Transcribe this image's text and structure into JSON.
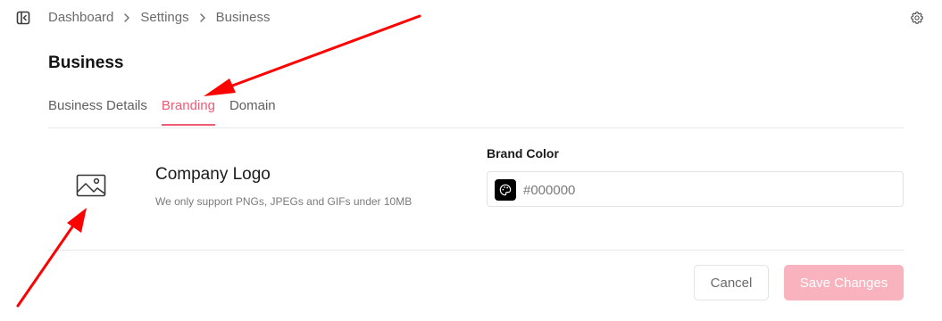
{
  "breadcrumb": {
    "items": [
      "Dashboard",
      "Settings",
      "Business"
    ]
  },
  "page": {
    "title": "Business"
  },
  "tabs": [
    {
      "label": "Business Details",
      "active": false
    },
    {
      "label": "Branding",
      "active": true
    },
    {
      "label": "Domain",
      "active": false
    }
  ],
  "logo": {
    "title": "Company Logo",
    "hint": "We only support PNGs, JPEGs and GIFs under 10MB",
    "icon": "image-icon"
  },
  "brand_color": {
    "label": "Brand Color",
    "value": "",
    "placeholder": "#000000",
    "swatch_color": "#000000",
    "icon": "palette-icon"
  },
  "actions": {
    "cancel_label": "Cancel",
    "save_label": "Save Changes"
  },
  "colors": {
    "accent": "#ef5b75",
    "save_disabled": "#f8b3be",
    "annotation_arrow": "#ff0000"
  },
  "icons": {
    "sidebar_toggle": "sidebar-toggle-icon",
    "breadcrumb_separator": "chevron-right-icon",
    "settings": "gear-icon"
  }
}
